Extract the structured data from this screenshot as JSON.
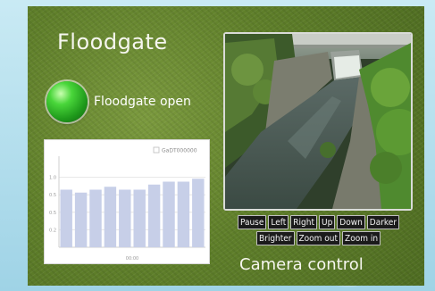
{
  "page": {
    "title": "Floodgate",
    "status_label": "Floodgate open",
    "status_color": "#2fb52a",
    "camera_label": "Camera control"
  },
  "camera": {
    "controls": [
      "Pause",
      "Left",
      "Right",
      "Up",
      "Down",
      "Darker",
      "Brighter",
      "Zoom out",
      "Zoom in"
    ]
  },
  "chart_data": {
    "type": "bar",
    "legend": "GaDT000000",
    "legend_position": "top-right",
    "xlabel": "00:00",
    "ylim": [
      0,
      1.2
    ],
    "yticks": [
      "0.2",
      "0.5",
      "0.5",
      "1.0"
    ],
    "values": [
      0.79,
      0.75,
      0.79,
      0.83,
      0.79,
      0.79,
      0.86,
      0.9,
      0.9,
      0.94
    ],
    "bar_color": "#c7cfe8",
    "grid": true
  }
}
